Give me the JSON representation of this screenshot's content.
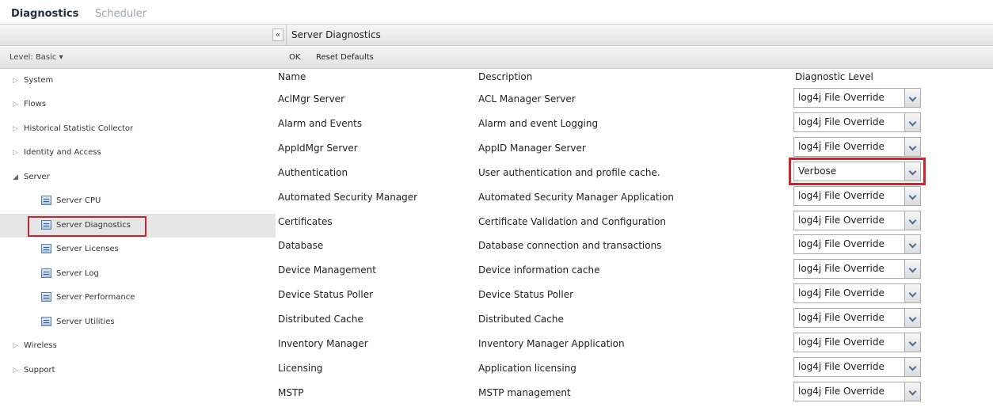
{
  "top_tabs": [
    {
      "label": "Diagnostics",
      "active": true
    },
    {
      "label": "Scheduler",
      "active": false
    }
  ],
  "header": {
    "collapse_label": "«",
    "panel_title": "Server Diagnostics"
  },
  "sidebar": {
    "level_label": "Level: Basic ▾",
    "items": [
      {
        "label": "System",
        "expanded": false
      },
      {
        "label": "Flows",
        "expanded": false
      },
      {
        "label": "Historical Statistic Collector",
        "expanded": false
      },
      {
        "label": "Identity and Access",
        "expanded": false
      },
      {
        "label": "Server",
        "expanded": true,
        "children": [
          {
            "label": "Server CPU"
          },
          {
            "label": "Server Diagnostics",
            "selected": true
          },
          {
            "label": "Server Licenses"
          },
          {
            "label": "Server Log"
          },
          {
            "label": "Server Performance"
          },
          {
            "label": "Server Utilities"
          }
        ]
      },
      {
        "label": "Wireless",
        "expanded": false
      },
      {
        "label": "Support",
        "expanded": false
      }
    ]
  },
  "toolbar": {
    "ok_label": "OK",
    "reset_label": "Reset Defaults"
  },
  "table": {
    "columns": [
      "Name",
      "Description",
      "Diagnostic Level"
    ],
    "rows": [
      {
        "name": "AclMgr Server",
        "description": "ACL Manager Server",
        "level": "log4j File Override"
      },
      {
        "name": "Alarm and Events",
        "description": "Alarm and event Logging",
        "level": "log4j File Override"
      },
      {
        "name": "AppIdMgr Server",
        "description": "AppID Manager Server",
        "level": "log4j File Override"
      },
      {
        "name": "Authentication",
        "description": "User authentication and profile cache.",
        "level": "Verbose",
        "highlighted": true
      },
      {
        "name": "Automated Security Manager",
        "description": "Automated Security Manager Application",
        "level": "log4j File Override"
      },
      {
        "name": "Certificates",
        "description": "Certificate Validation and Configuration",
        "level": "log4j File Override"
      },
      {
        "name": "Database",
        "description": "Database connection and transactions",
        "level": "log4j File Override"
      },
      {
        "name": "Device Management",
        "description": "Device information cache",
        "level": "log4j File Override"
      },
      {
        "name": "Device Status Poller",
        "description": "Device Status Poller",
        "level": "log4j File Override"
      },
      {
        "name": "Distributed Cache",
        "description": "Distributed Cache",
        "level": "log4j File Override"
      },
      {
        "name": "Inventory Manager",
        "description": "Inventory Manager Application",
        "level": "log4j File Override"
      },
      {
        "name": "Licensing",
        "description": "Application licensing",
        "level": "log4j File Override"
      },
      {
        "name": "MSTP",
        "description": "MSTP management",
        "level": "log4j File Override"
      }
    ]
  },
  "colors": {
    "highlight_border": "#c9252f",
    "selected_row_bg": "#e6e6e6",
    "header_gradient_top": "#f6f6f6",
    "header_gradient_bottom": "#e2e2e2"
  }
}
